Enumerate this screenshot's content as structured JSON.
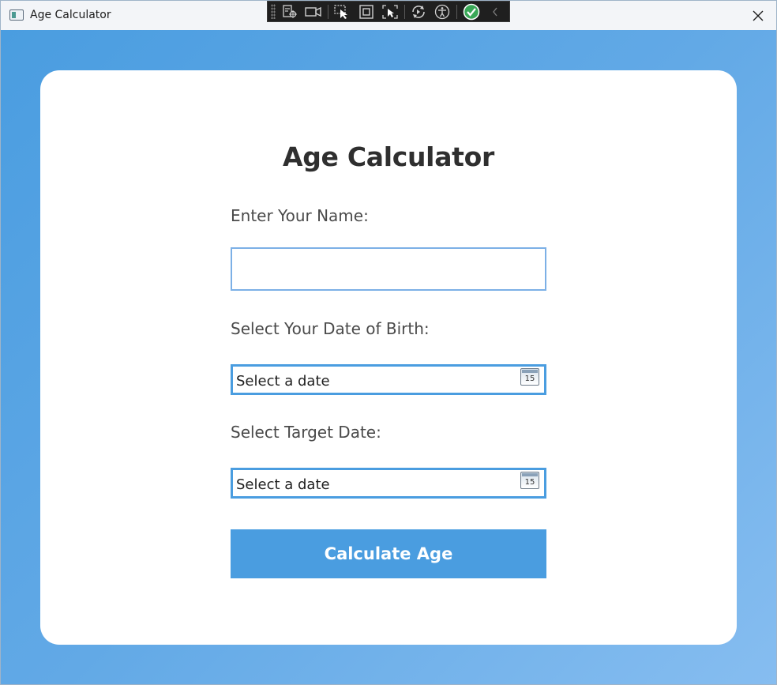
{
  "window": {
    "title": "Age Calculator"
  },
  "debug_toolbar": {
    "items": [
      "live-visual-tree-icon",
      "record-video-icon",
      "select-element-icon",
      "display-layout-adorners-icon",
      "track-focus-icon",
      "hot-reload-icon",
      "accessibility-icon",
      "binding-check-icon",
      "collapse-chevron-icon"
    ]
  },
  "card": {
    "title": "Age Calculator",
    "name_label": "Enter Your Name:",
    "name_value": "",
    "dob_label": "Select Your Date of Birth:",
    "dob_placeholder": "Select a date",
    "dob_calendar_day": "15",
    "target_label": "Select Target Date:",
    "target_placeholder": "Select a date",
    "target_calendar_day": "15",
    "button_label": "Calculate Age"
  },
  "colors": {
    "background_gradient_start": "#4a9de0",
    "background_gradient_end": "#86bdf0",
    "card": "#ffffff",
    "accent": "#4a9de0",
    "title_text": "#2f2f2f",
    "label_text": "#4a4a4a"
  }
}
